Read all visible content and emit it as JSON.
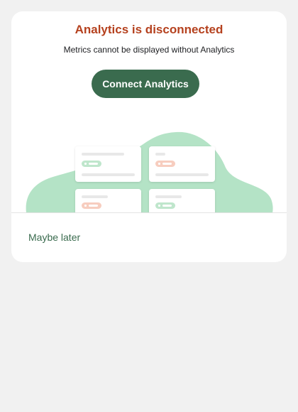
{
  "dialog": {
    "title": "Analytics is disconnected",
    "subtitle": "Metrics cannot be displayed without Analytics",
    "connect_button_label": "Connect Analytics",
    "dismiss_label": "Maybe later"
  },
  "illustration": {
    "name": "metrics-cards-illustration",
    "blob_color": "#b4e3c6",
    "cards": [
      {
        "badge": "up",
        "badge_color": "#bfe6cc"
      },
      {
        "badge": "down",
        "badge_color": "#f7cdbf"
      },
      {
        "badge": "down",
        "badge_color": "#f7cdbf"
      },
      {
        "badge": "up",
        "badge_color": "#bfe6cc"
      }
    ]
  },
  "colors": {
    "accent": "#3a6b4e",
    "title": "#b5411e",
    "background": "#f1f1f1"
  }
}
